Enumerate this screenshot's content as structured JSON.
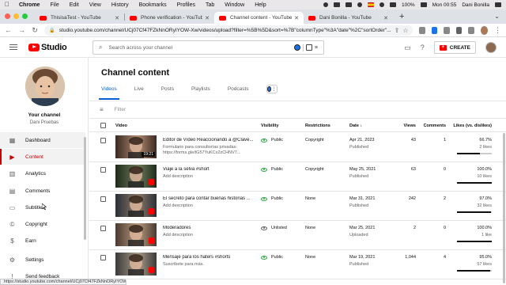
{
  "menubar": {
    "app": "Chrome",
    "menus": [
      "File",
      "Edit",
      "View",
      "History",
      "Bookmarks",
      "Profiles",
      "Tab",
      "Window",
      "Help"
    ],
    "battery": "100%",
    "datetime": "Mon 00:55",
    "user": "Dani Bonilla"
  },
  "browser": {
    "tabs": [
      {
        "label": "ThisisaTest - YouTube"
      },
      {
        "label": "Phone verification - YouTube"
      },
      {
        "label": "Channel content - YouTube St..."
      },
      {
        "label": "Dani Bonilla - YouTube"
      }
    ],
    "url": "studio.youtube.com/channel/UCj07Cf47FZkNnORyIYOW-Xw/videos/upload?filter=%5B%5D&sort=%7B\"columnType\"%3A\"date\"%2C\"sortOrder\"...",
    "status_url": "https://studio.youtube.com/channel/UCj07Cf47FZkNnORyIYOW-Xw"
  },
  "header": {
    "logo_text": "Studio",
    "search_placeholder": "Search across your channel",
    "create_label": "CREATE"
  },
  "sidebar": {
    "channel_label": "Your channel",
    "channel_name": "Dani Pruebas",
    "items": [
      {
        "label": "Dashboard",
        "icon": "dashboard-icon"
      },
      {
        "label": "Content",
        "icon": "content-icon"
      },
      {
        "label": "Analytics",
        "icon": "analytics-icon"
      },
      {
        "label": "Comments",
        "icon": "comments-icon"
      },
      {
        "label": "Subtitles",
        "icon": "subtitles-icon"
      },
      {
        "label": "Copyright",
        "icon": "copyright-icon"
      },
      {
        "label": "Earn",
        "icon": "earn-icon"
      },
      {
        "label": "Settings",
        "icon": "settings-icon"
      },
      {
        "label": "Send feedback",
        "icon": "feedback-icon"
      }
    ]
  },
  "main": {
    "title": "Channel content",
    "tabs": [
      "Videos",
      "Live",
      "Posts",
      "Playlists",
      "Podcasts"
    ],
    "filter_placeholder": "Filter",
    "columns": {
      "video": "Video",
      "visibility": "Visibility",
      "restrictions": "Restrictions",
      "date": "Date ↓",
      "views": "Views",
      "comments": "Comments",
      "likes": "Likes (vs. dislikes)"
    },
    "rows": [
      {
        "title": "Editor de Vídeo Reaccionando a @Clave...",
        "desc": "Formulario para consultorías privadas: https://forms.gle/tG57YuKCx2zCHNV7...",
        "duration": "19:21",
        "is_short": false,
        "visibility": "Public",
        "restrictions": "Copyright",
        "date": "Apr 21, 2023",
        "status": "Published",
        "views": "43",
        "comments": "1",
        "likes_pct": "66.7%",
        "likes_count": "2 likes",
        "likes_ratio": 0.667
      },
      {
        "title": "Viaje a la selva #short",
        "desc": "Add description",
        "duration": "",
        "is_short": true,
        "visibility": "Public",
        "restrictions": "Copyright",
        "date": "May 25, 2021",
        "status": "Published",
        "views": "63",
        "comments": "0",
        "likes_pct": "100.0%",
        "likes_count": "10 likes",
        "likes_ratio": 1.0
      },
      {
        "title": "El secreto para contar buenas historias ...",
        "desc": "Add description",
        "duration": "",
        "is_short": true,
        "visibility": "Public",
        "restrictions": "None",
        "date": "Mar 31, 2021",
        "status": "Published",
        "views": "242",
        "comments": "2",
        "likes_pct": "97.0%",
        "likes_count": "32 likes",
        "likes_ratio": 0.97
      },
      {
        "title": "Moderadores",
        "desc": "Add description",
        "duration": "",
        "is_short": true,
        "visibility": "Unlisted",
        "restrictions": "None",
        "date": "Mar 25, 2021",
        "status": "Uploaded",
        "views": "2",
        "comments": "0",
        "likes_pct": "100.0%",
        "likes_count": "1 like",
        "likes_ratio": 1.0
      },
      {
        "title": "Mensaje para los haters #shorts",
        "desc": "Suscribete para más.",
        "duration": "",
        "is_short": true,
        "visibility": "Public",
        "restrictions": "None",
        "date": "Mar 19, 2021",
        "status": "Published",
        "views": "1,044",
        "comments": "4",
        "likes_pct": "95.0%",
        "likes_count": "57 likes",
        "likes_ratio": 0.95
      }
    ]
  }
}
